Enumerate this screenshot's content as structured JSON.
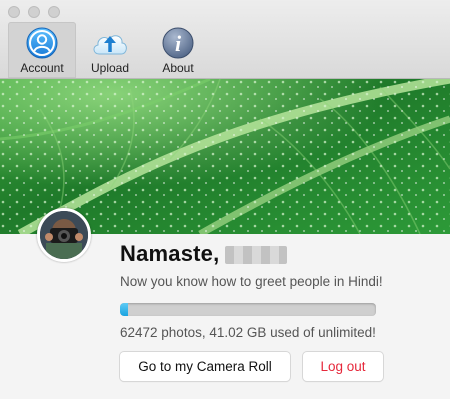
{
  "toolbar": {
    "items": [
      {
        "label": "Account",
        "icon": "account-icon",
        "active": true
      },
      {
        "label": "Upload",
        "icon": "cloud-upload-icon",
        "active": false
      },
      {
        "label": "About",
        "icon": "info-icon",
        "active": false
      }
    ]
  },
  "profile": {
    "greeting": "Namaste,",
    "subtitle": "Now you know how to greet people in Hindi!"
  },
  "storage": {
    "used_fraction": 0.03,
    "usage_text": "62472 photos, 41.02 GB used of unlimited!"
  },
  "actions": {
    "camera_roll_label": "Go to my Camera Roll",
    "logout_label": "Log out"
  },
  "colors": {
    "accent": "#1aa3e0",
    "logout": "#e6283b"
  }
}
